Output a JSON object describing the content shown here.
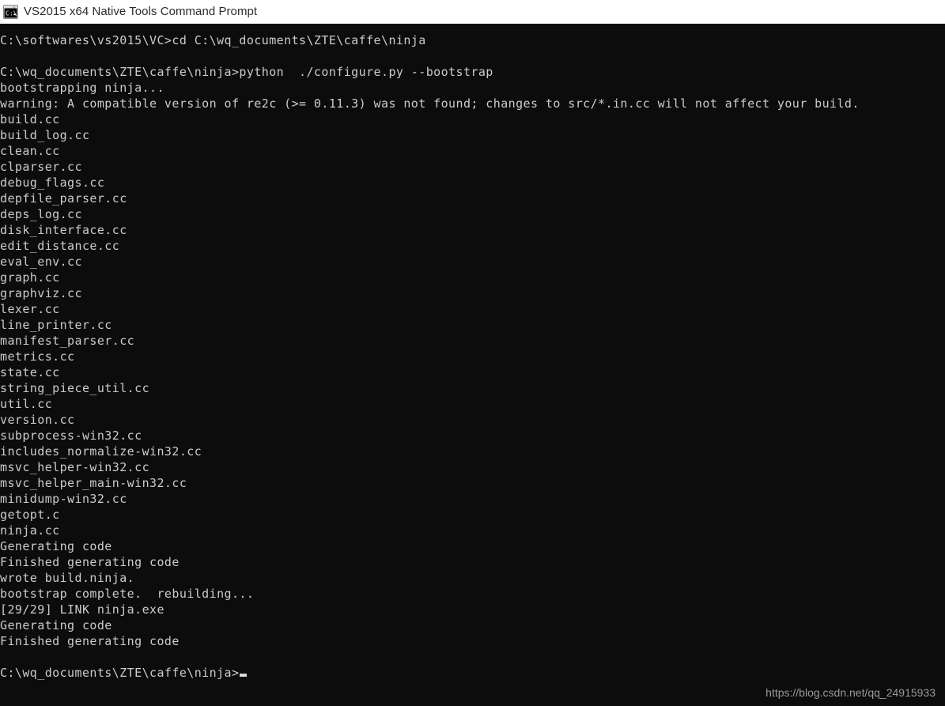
{
  "window": {
    "title": "VS2015 x64 Native Tools Command Prompt",
    "icon": "console-cmd-icon",
    "titlebar_bg": "#ffffff",
    "titlebar_fg": "#2b2b2b",
    "console_bg": "#0c0c0c",
    "console_fg": "#cccccc"
  },
  "console": {
    "cursor": "block-cursor",
    "lines": [
      "C:\\softwares\\vs2015\\VC>cd C:\\wq_documents\\ZTE\\caffe\\ninja",
      "",
      "C:\\wq_documents\\ZTE\\caffe\\ninja>python  ./configure.py --bootstrap",
      "bootstrapping ninja...",
      "warning: A compatible version of re2c (>= 0.11.3) was not found; changes to src/*.in.cc will not affect your build.",
      "build.cc",
      "build_log.cc",
      "clean.cc",
      "clparser.cc",
      "debug_flags.cc",
      "depfile_parser.cc",
      "deps_log.cc",
      "disk_interface.cc",
      "edit_distance.cc",
      "eval_env.cc",
      "graph.cc",
      "graphviz.cc",
      "lexer.cc",
      "line_printer.cc",
      "manifest_parser.cc",
      "metrics.cc",
      "state.cc",
      "string_piece_util.cc",
      "util.cc",
      "version.cc",
      "subprocess-win32.cc",
      "includes_normalize-win32.cc",
      "msvc_helper-win32.cc",
      "msvc_helper_main-win32.cc",
      "minidump-win32.cc",
      "getopt.c",
      "ninja.cc",
      "Generating code",
      "Finished generating code",
      "wrote build.ninja.",
      "bootstrap complete.  rebuilding...",
      "[29/29] LINK ninja.exe",
      "Generating code",
      "Finished generating code",
      ""
    ],
    "prompt": "C:\\wq_documents\\ZTE\\caffe\\ninja>"
  },
  "watermark": {
    "text": "https://blog.csdn.net/qq_24915933"
  }
}
